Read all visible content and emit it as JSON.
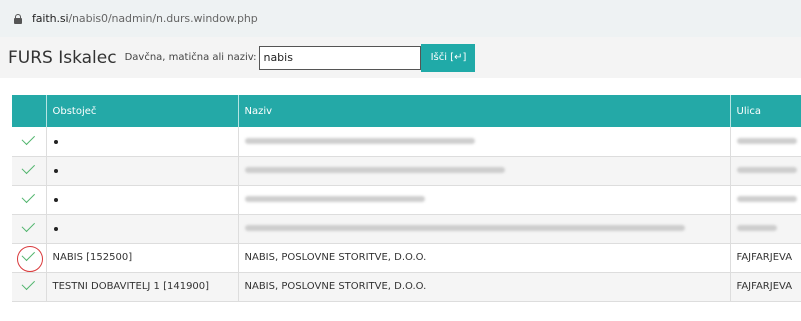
{
  "browser": {
    "url_host": "faith.si",
    "url_path": "/nabis0/nadmin/n.durs.window.php"
  },
  "header": {
    "title": "FURS Iskalec",
    "search_label": "Davčna, matična ali naziv:",
    "search_value": "nabis",
    "search_button": "Išči [↵]"
  },
  "table": {
    "columns": [
      "",
      "Obstoječ",
      "Naziv",
      "Ulica"
    ],
    "rows": [
      {
        "checked": true,
        "obstojec": "•",
        "naziv": "",
        "ulica": "",
        "redacted": true,
        "highlighted": false
      },
      {
        "checked": true,
        "obstojec": "•",
        "naziv": "",
        "ulica": "",
        "redacted": true,
        "highlighted": false
      },
      {
        "checked": true,
        "obstojec": "•",
        "naziv": "",
        "ulica": "",
        "redacted": true,
        "highlighted": false
      },
      {
        "checked": true,
        "obstojec": "•",
        "naziv": "",
        "ulica": "",
        "redacted": true,
        "highlighted": false
      },
      {
        "checked": true,
        "obstojec": "NABIS [152500]",
        "naziv": "NABIS, POSLOVNE STORITVE, D.O.O.",
        "ulica": "FAJFARJEVA",
        "redacted": false,
        "highlighted": true
      },
      {
        "checked": true,
        "obstojec": "TESTNI DOBAVITELJ 1 [141900]",
        "naziv": "NABIS, POSLOVNE STORITVE, D.O.O.",
        "ulica": "FAJFARJEVA",
        "redacted": false,
        "highlighted": false
      }
    ]
  },
  "colors": {
    "accent": "#24a9a7",
    "check": "#52b56e",
    "highlight_circle": "#d9383a"
  }
}
